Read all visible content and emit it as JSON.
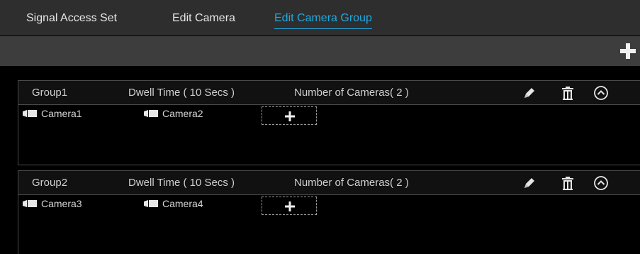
{
  "tabs": [
    {
      "label": "Signal Access Set",
      "active": false
    },
    {
      "label": "Edit Camera",
      "active": false
    },
    {
      "label": "Edit Camera Group",
      "active": true
    }
  ],
  "toolbar": {
    "add_icon": "plus-icon"
  },
  "groups": [
    {
      "name": "Group1",
      "dwell": "Dwell Time ( 10 Secs )",
      "count": "Number of Cameras( 2 )",
      "cameras": [
        "Camera1",
        "Camera2"
      ]
    },
    {
      "name": "Group2",
      "dwell": "Dwell Time ( 10 Secs )",
      "count": "Number of Cameras( 2 )",
      "cameras": [
        "Camera3",
        "Camera4"
      ]
    }
  ],
  "colors": {
    "accent": "#1fa9e3",
    "tab_bar": "#2e2e2e",
    "toolbar": "#3d3d3d",
    "background": "#000000"
  }
}
